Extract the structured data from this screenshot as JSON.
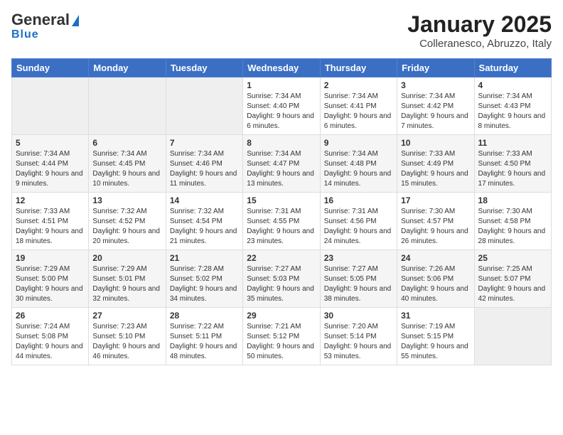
{
  "header": {
    "logo_general": "General",
    "logo_blue": "Blue",
    "month_year": "January 2025",
    "location": "Colleranesco, Abruzzo, Italy"
  },
  "weekdays": [
    "Sunday",
    "Monday",
    "Tuesday",
    "Wednesday",
    "Thursday",
    "Friday",
    "Saturday"
  ],
  "weeks": [
    [
      {
        "day": null
      },
      {
        "day": null
      },
      {
        "day": null
      },
      {
        "day": 1,
        "sunrise": "7:34 AM",
        "sunset": "4:40 PM",
        "daylight": "9 hours and 6 minutes."
      },
      {
        "day": 2,
        "sunrise": "7:34 AM",
        "sunset": "4:41 PM",
        "daylight": "9 hours and 6 minutes."
      },
      {
        "day": 3,
        "sunrise": "7:34 AM",
        "sunset": "4:42 PM",
        "daylight": "9 hours and 7 minutes."
      },
      {
        "day": 4,
        "sunrise": "7:34 AM",
        "sunset": "4:43 PM",
        "daylight": "9 hours and 8 minutes."
      }
    ],
    [
      {
        "day": 5,
        "sunrise": "7:34 AM",
        "sunset": "4:44 PM",
        "daylight": "9 hours and 9 minutes."
      },
      {
        "day": 6,
        "sunrise": "7:34 AM",
        "sunset": "4:45 PM",
        "daylight": "9 hours and 10 minutes."
      },
      {
        "day": 7,
        "sunrise": "7:34 AM",
        "sunset": "4:46 PM",
        "daylight": "9 hours and 11 minutes."
      },
      {
        "day": 8,
        "sunrise": "7:34 AM",
        "sunset": "4:47 PM",
        "daylight": "9 hours and 13 minutes."
      },
      {
        "day": 9,
        "sunrise": "7:34 AM",
        "sunset": "4:48 PM",
        "daylight": "9 hours and 14 minutes."
      },
      {
        "day": 10,
        "sunrise": "7:33 AM",
        "sunset": "4:49 PM",
        "daylight": "9 hours and 15 minutes."
      },
      {
        "day": 11,
        "sunrise": "7:33 AM",
        "sunset": "4:50 PM",
        "daylight": "9 hours and 17 minutes."
      }
    ],
    [
      {
        "day": 12,
        "sunrise": "7:33 AM",
        "sunset": "4:51 PM",
        "daylight": "9 hours and 18 minutes."
      },
      {
        "day": 13,
        "sunrise": "7:32 AM",
        "sunset": "4:52 PM",
        "daylight": "9 hours and 20 minutes."
      },
      {
        "day": 14,
        "sunrise": "7:32 AM",
        "sunset": "4:54 PM",
        "daylight": "9 hours and 21 minutes."
      },
      {
        "day": 15,
        "sunrise": "7:31 AM",
        "sunset": "4:55 PM",
        "daylight": "9 hours and 23 minutes."
      },
      {
        "day": 16,
        "sunrise": "7:31 AM",
        "sunset": "4:56 PM",
        "daylight": "9 hours and 24 minutes."
      },
      {
        "day": 17,
        "sunrise": "7:30 AM",
        "sunset": "4:57 PM",
        "daylight": "9 hours and 26 minutes."
      },
      {
        "day": 18,
        "sunrise": "7:30 AM",
        "sunset": "4:58 PM",
        "daylight": "9 hours and 28 minutes."
      }
    ],
    [
      {
        "day": 19,
        "sunrise": "7:29 AM",
        "sunset": "5:00 PM",
        "daylight": "9 hours and 30 minutes."
      },
      {
        "day": 20,
        "sunrise": "7:29 AM",
        "sunset": "5:01 PM",
        "daylight": "9 hours and 32 minutes."
      },
      {
        "day": 21,
        "sunrise": "7:28 AM",
        "sunset": "5:02 PM",
        "daylight": "9 hours and 34 minutes."
      },
      {
        "day": 22,
        "sunrise": "7:27 AM",
        "sunset": "5:03 PM",
        "daylight": "9 hours and 35 minutes."
      },
      {
        "day": 23,
        "sunrise": "7:27 AM",
        "sunset": "5:05 PM",
        "daylight": "9 hours and 38 minutes."
      },
      {
        "day": 24,
        "sunrise": "7:26 AM",
        "sunset": "5:06 PM",
        "daylight": "9 hours and 40 minutes."
      },
      {
        "day": 25,
        "sunrise": "7:25 AM",
        "sunset": "5:07 PM",
        "daylight": "9 hours and 42 minutes."
      }
    ],
    [
      {
        "day": 26,
        "sunrise": "7:24 AM",
        "sunset": "5:08 PM",
        "daylight": "9 hours and 44 minutes."
      },
      {
        "day": 27,
        "sunrise": "7:23 AM",
        "sunset": "5:10 PM",
        "daylight": "9 hours and 46 minutes."
      },
      {
        "day": 28,
        "sunrise": "7:22 AM",
        "sunset": "5:11 PM",
        "daylight": "9 hours and 48 minutes."
      },
      {
        "day": 29,
        "sunrise": "7:21 AM",
        "sunset": "5:12 PM",
        "daylight": "9 hours and 50 minutes."
      },
      {
        "day": 30,
        "sunrise": "7:20 AM",
        "sunset": "5:14 PM",
        "daylight": "9 hours and 53 minutes."
      },
      {
        "day": 31,
        "sunrise": "7:19 AM",
        "sunset": "5:15 PM",
        "daylight": "9 hours and 55 minutes."
      },
      {
        "day": null
      }
    ]
  ]
}
